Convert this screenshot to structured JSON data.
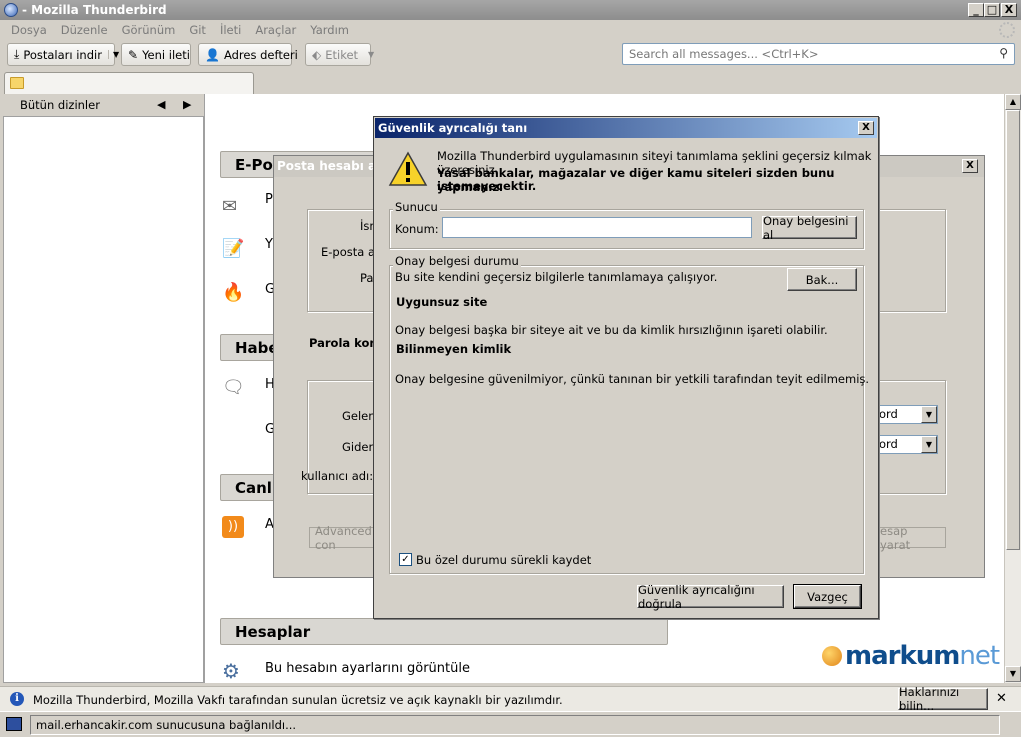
{
  "window": {
    "title": "- Mozilla Thunderbird",
    "min_glyph": "_",
    "max_glyph": "□",
    "close_glyph": "X"
  },
  "menu": [
    {
      "label": "Dosya"
    },
    {
      "label": "Düzenle"
    },
    {
      "label": "Görünüm"
    },
    {
      "label": "Git"
    },
    {
      "label": "İleti"
    },
    {
      "label": "Araçlar"
    },
    {
      "label": "Yardım"
    }
  ],
  "toolbar": {
    "get_mail": "Postaları indir",
    "write": "Yeni ileti",
    "address_book": "Adres defteri",
    "tag": "Etiket",
    "search_placeholder": "Search all messages... <Ctrl+K>"
  },
  "folder_pane": {
    "header": "Bütün dizinler"
  },
  "main": {
    "sections": [
      {
        "title": "E-Po"
      },
      {
        "title": "Habe"
      },
      {
        "title": "Canl"
      },
      {
        "title": "Hesaplar"
      }
    ],
    "email_items": [
      "P",
      "Y",
      "G"
    ],
    "news_items": [
      "H",
      "G"
    ],
    "feeds_items": [
      "A"
    ],
    "accounts_item": "Bu hesabın ayarlarını görüntüle"
  },
  "account_dialog": {
    "title": "Posta hesabı aya",
    "close_glyph": "X",
    "name_label": "İsm",
    "email_label": "E-posta ad",
    "password_label": "Pa",
    "password_check": "Parola kont",
    "incoming_label": "Gelen:",
    "outgoing_label": "Giden:",
    "username_label": "kullanıcı adı:",
    "incoming_auth": "ord",
    "outgoing_auth": "ord",
    "advanced_btn": "Advanced con",
    "create_btn": "esap yarat"
  },
  "security_dialog": {
    "title": "Güvenlik ayrıcalığı tanı",
    "close_glyph": "X",
    "warning_line1": "Mozilla Thunderbird uygulamasının siteyi tanımlama şeklini geçersiz kılmak üzeresiniz.",
    "warning_line2": "Yasal bankalar, mağazalar ve diğer kamu siteleri sizden bunu yapmanızı",
    "warning_line3": "istemeyecektir.",
    "server_legend": "Sunucu",
    "location_label": "Konum:",
    "location_value": "",
    "get_cert_btn": "Onay belgesini al",
    "status_legend": "Onay belgesi durumu",
    "status_desc": "Bu site kendini geçersiz bilgilerle tanımlamaya çalışıyor.",
    "view_btn": "Bak...",
    "wrong_site_title": "Uygunsuz site",
    "wrong_site_desc": "Onay belgesi başka bir siteye ait ve bu da kimlik hırsızlığının işareti olabilir.",
    "unknown_title": "Bilinmeyen kimlik",
    "unknown_desc": "Onay belgesine güvenilmiyor, çünkü tanınan bir yetkili tarafından teyit edilmemiş.",
    "permanent_label": "Bu özel durumu sürekli kaydet",
    "permanent_checked": true,
    "confirm_btn": "Güvenlik ayrıcalığını doğrula",
    "cancel_btn": "Vazgeç"
  },
  "info_bar": {
    "text": "Mozilla Thunderbird, Mozilla Vakfı tarafından sunulan ücretsiz ve açık kaynaklı bir yazılımdır.",
    "rights_btn": "Haklarınızı bilin...",
    "close_glyph": "✕"
  },
  "status": {
    "text": "mail.erhancakir.com sunucusuna bağlanıldı..."
  },
  "logo": {
    "main": "markum",
    "suffix": "net"
  }
}
